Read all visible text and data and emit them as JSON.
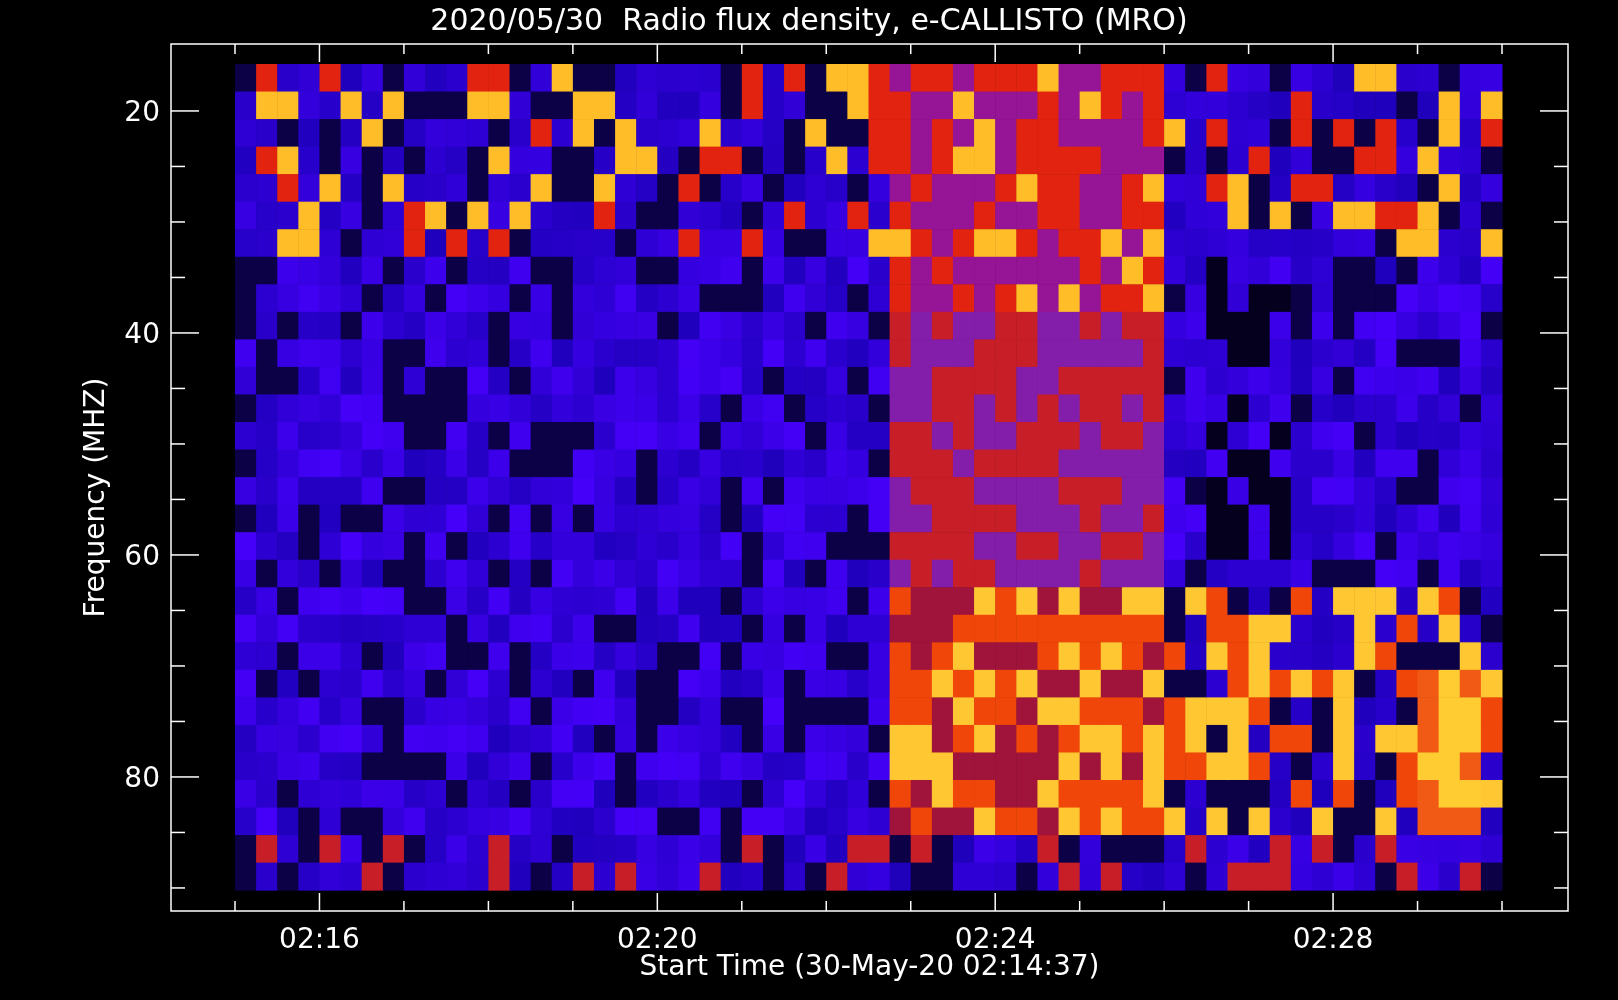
{
  "title": "2020/05/30  Radio flux density, e-CALLISTO (MRO)",
  "plot": {
    "y_axis": {
      "label": "Frequency (MHZ)",
      "ticks": [
        "20",
        "40",
        "60",
        "80"
      ]
    },
    "x_axis": {
      "label": "Start Time (30-May-20 02:14:37)",
      "ticks": [
        "02:16",
        "02:20",
        "02:24",
        "02:28"
      ]
    }
  }
}
